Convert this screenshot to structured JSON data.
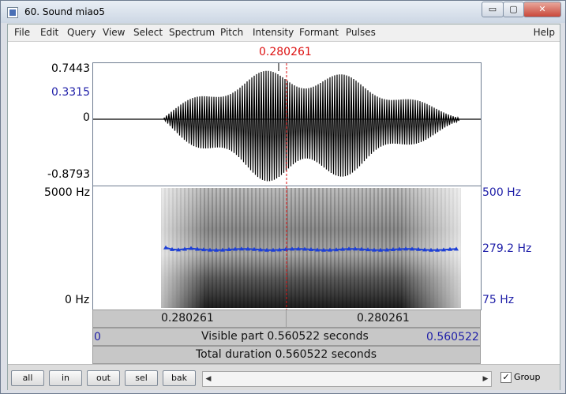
{
  "window": {
    "title": "60. Sound miao5",
    "minimize": "▭",
    "maximize": "▢",
    "close": "✕"
  },
  "menu": [
    "File",
    "Edit",
    "Query",
    "View",
    "Select",
    "Spectrum",
    "Pitch",
    "Intensity",
    "Formant",
    "Pulses"
  ],
  "menu_help": "Help",
  "cursor_time": "0.280261",
  "wave_axis": {
    "max": "0.7443",
    "cursor_value": "0.3315",
    "zero": "0",
    "min": "-0.8793"
  },
  "spec_axis": {
    "left_top": "5000 Hz",
    "left_bottom": "0 Hz",
    "right_top": "500 Hz",
    "right_mid": "279.2 Hz",
    "right_bottom": "75 Hz"
  },
  "time_bar": {
    "left": "0.280261",
    "right": "0.280261"
  },
  "visible_bar": {
    "start": "0",
    "label": "Visible part 0.560522 seconds",
    "end": "0.560522"
  },
  "total_bar": {
    "label": "Total duration 0.560522 seconds"
  },
  "buttons": {
    "all": "all",
    "in": "in",
    "out": "out",
    "sel": "sel",
    "bak": "bak"
  },
  "scroll": {
    "left": "◀",
    "right": "▶"
  },
  "group": {
    "label": "Group",
    "checked": "✓"
  },
  "colors": {
    "cursor": "#dd1111",
    "pitch": "#1d3fd6",
    "axis_blue": "#1e1ea8"
  }
}
